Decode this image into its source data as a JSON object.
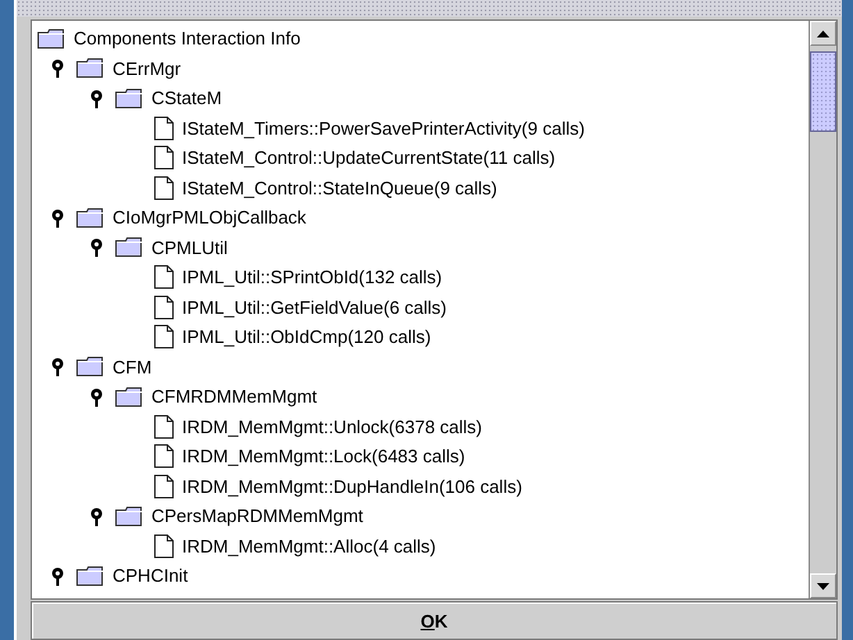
{
  "tree": {
    "label": "Components Interaction Info",
    "kind": "folder",
    "children": [
      {
        "label": "CErrMgr",
        "kind": "folder",
        "expanded": true,
        "children": [
          {
            "label": "CStateM",
            "kind": "folder",
            "expanded": true,
            "children": [
              {
                "label": "IStateM_Timers::PowerSavePrinterActivity(9 calls)",
                "kind": "leaf"
              },
              {
                "label": "IStateM_Control::UpdateCurrentState(11 calls)",
                "kind": "leaf"
              },
              {
                "label": "IStateM_Control::StateInQueue(9 calls)",
                "kind": "leaf"
              }
            ]
          }
        ]
      },
      {
        "label": "CIoMgrPMLObjCallback",
        "kind": "folder",
        "expanded": true,
        "children": [
          {
            "label": "CPMLUtil",
            "kind": "folder",
            "expanded": true,
            "children": [
              {
                "label": "IPML_Util::SPrintObId(132 calls)",
                "kind": "leaf"
              },
              {
                "label": "IPML_Util::GetFieldValue(6 calls)",
                "kind": "leaf"
              },
              {
                "label": "IPML_Util::ObIdCmp(120 calls)",
                "kind": "leaf"
              }
            ]
          }
        ]
      },
      {
        "label": "CFM",
        "kind": "folder",
        "expanded": true,
        "children": [
          {
            "label": "CFMRDMMemMgmt",
            "kind": "folder",
            "expanded": true,
            "children": [
              {
                "label": "IRDM_MemMgmt::Unlock(6378 calls)",
                "kind": "leaf"
              },
              {
                "label": "IRDM_MemMgmt::Lock(6483 calls)",
                "kind": "leaf"
              },
              {
                "label": "IRDM_MemMgmt::DupHandleIn(106 calls)",
                "kind": "leaf"
              }
            ]
          },
          {
            "label": "CPersMapRDMMemMgmt",
            "kind": "folder",
            "expanded": true,
            "children": [
              {
                "label": "IRDM_MemMgmt::Alloc(4 calls)",
                "kind": "leaf"
              }
            ]
          }
        ]
      },
      {
        "label": "CPHCInit",
        "kind": "folder",
        "expanded": true
      }
    ]
  },
  "button": {
    "label": "OK",
    "first_letter_underlined": true
  }
}
